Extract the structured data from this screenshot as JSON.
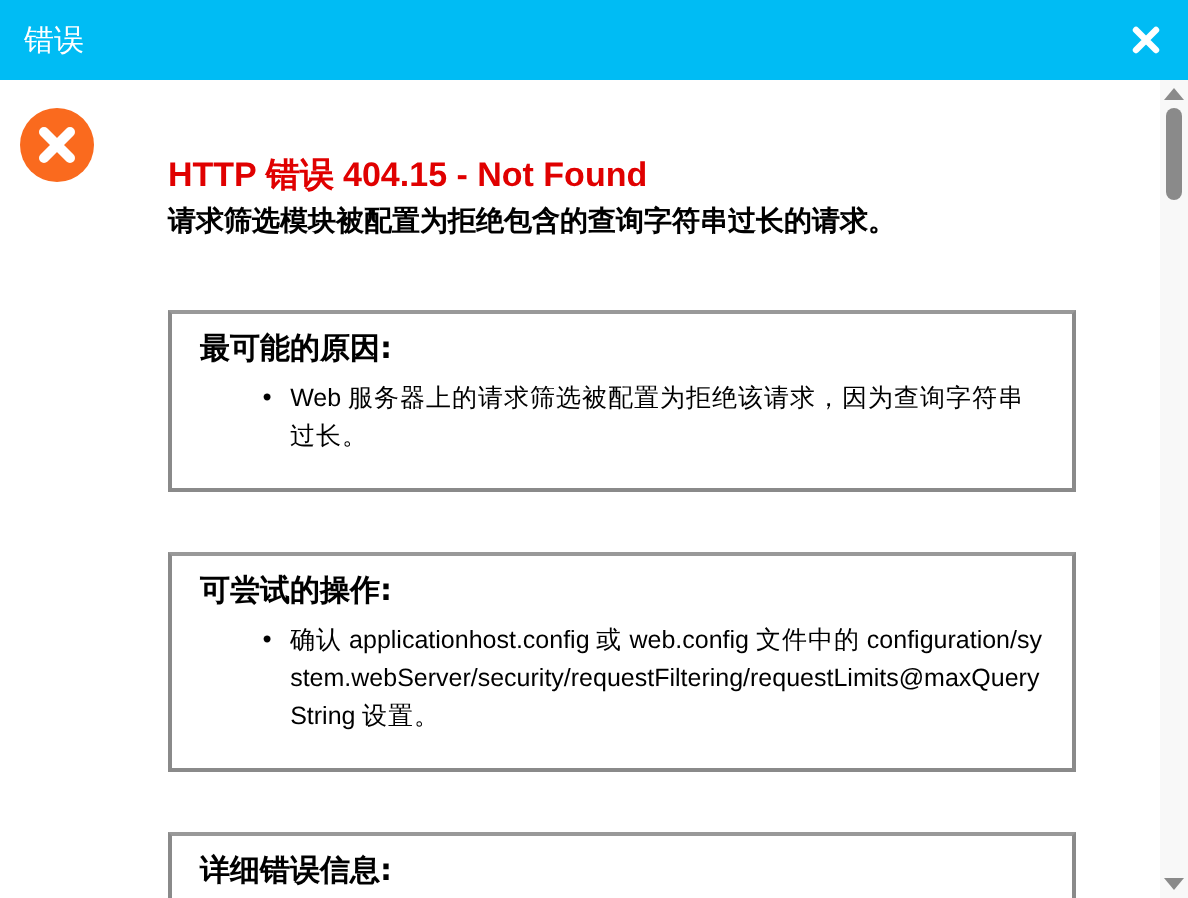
{
  "window": {
    "title": "错误"
  },
  "error": {
    "heading": "HTTP 错误 404.15 - Not Found",
    "message": "请求筛选模块被配置为拒绝包含的查询字符串过长的请求。"
  },
  "sections": [
    {
      "title": "最可能的原因:",
      "items": [
        {
          "marker": "•",
          "text": "Web 服务器上的请求筛选被配置为拒绝该请求，因为查询字符串过长。"
        }
      ]
    },
    {
      "title": "可尝试的操作:",
      "items": [
        {
          "marker": "•",
          "text": "确认 applicationhost.config 或 web.config 文件中的 configuration/system.webServer/security/requestFiltering/requestLimits@maxQueryString 设置。"
        }
      ]
    },
    {
      "title": "详细错误信息:"
    }
  ]
}
